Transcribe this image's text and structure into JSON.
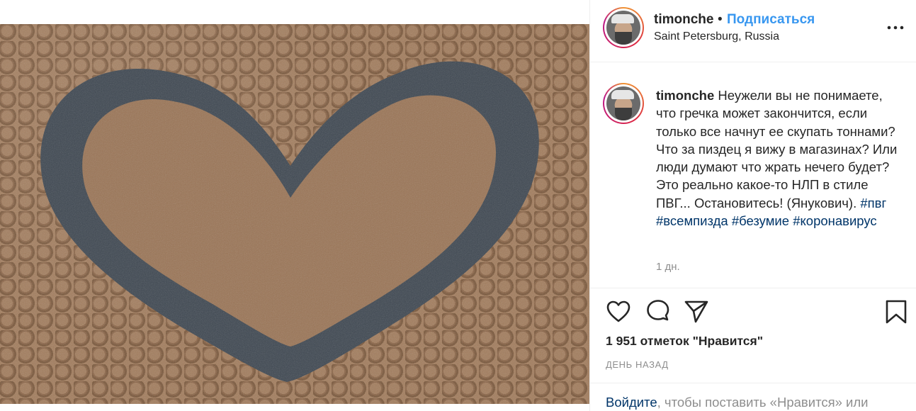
{
  "post": {
    "image_alt": "buckwheat heart"
  },
  "header": {
    "username": "timonche",
    "separator": "•",
    "follow_label": "Подписаться",
    "location": "Saint Petersburg, Russia"
  },
  "caption": {
    "username": "timonche",
    "text": "Неужели вы не понимаете, что гречка может закончится, если только все начнут ее скупать тоннами? Что за пиздец я вижу в магазинах? Или люди думают что жрать нечего будет? Это реально какое-то НЛП в стиле ПВГ... Остановитесь! (Янукович).",
    "hashtags": [
      "#пвг",
      "#всемпизда",
      "#безумие",
      "#коронавирус"
    ],
    "time": "1 дн."
  },
  "actions": {
    "icons": [
      "heart-icon",
      "comment-icon",
      "share-icon",
      "bookmark-icon"
    ]
  },
  "stats": {
    "likes": "1 951 отметок \"Нравится\"",
    "posted_ago": "ДЕНЬ НАЗАД"
  },
  "login_prompt": {
    "link": "Войдите",
    "rest": ", чтобы поставить «Нравится» или"
  },
  "colors": {
    "link_blue": "#3897f0",
    "hashtag_blue": "#003569",
    "muted": "#8e8e8e",
    "text": "#262626",
    "photo_background": "#3d4650"
  }
}
